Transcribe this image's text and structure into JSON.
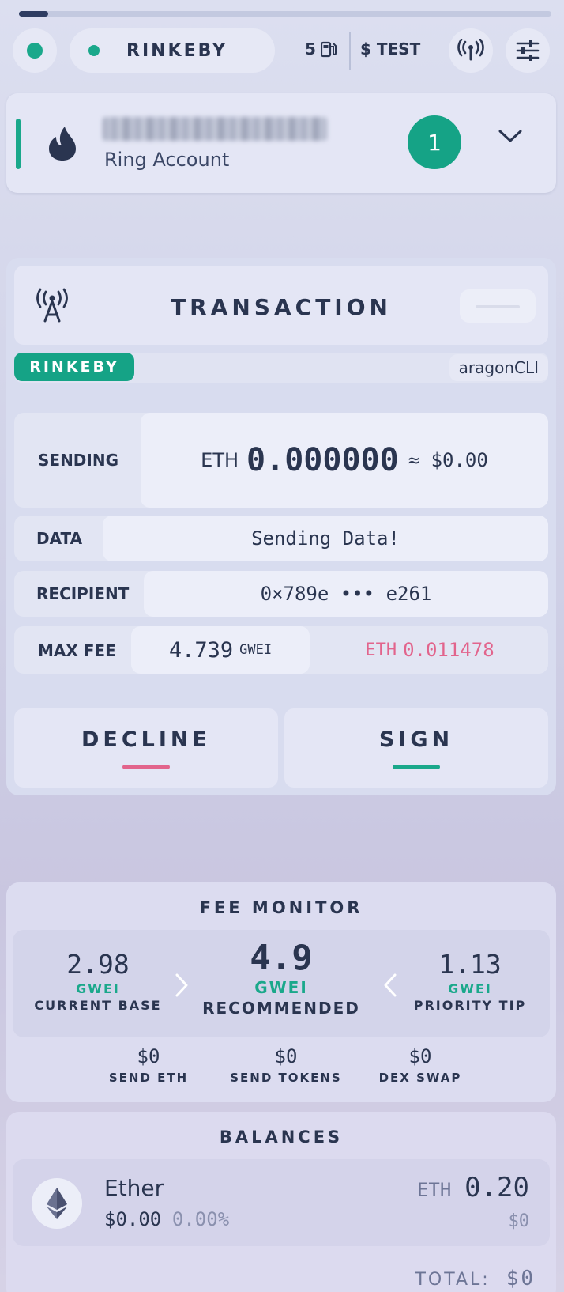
{
  "progress": {
    "fraction": 0.055
  },
  "header": {
    "network_label": "RINKEBY",
    "gas_price": "5",
    "currency_label": "$ TEST"
  },
  "account": {
    "type_label": "Ring Account",
    "pending_count": "1"
  },
  "transaction": {
    "title": "TRANSACTION",
    "network_badge": "RINKEBY",
    "origin": "aragonCLI",
    "sending": {
      "label": "SENDING",
      "currency": "ETH",
      "amount": "0.000000",
      "usd": "≈ $0.00"
    },
    "data": {
      "label": "DATA",
      "value": "Sending Data!"
    },
    "recipient": {
      "label": "RECIPIENT",
      "value": "0×789e ••• e261"
    },
    "max_fee": {
      "label": "MAX FEE",
      "gwei": "4.739",
      "gwei_unit": "GWEI",
      "eth_label": "ETH",
      "eth": "0.011478"
    },
    "decline_label": "DECLINE",
    "sign_label": "SIGN"
  },
  "fee_monitor": {
    "title": "FEE MONITOR",
    "current_base": {
      "value": "2.98",
      "unit": "GWEI",
      "label": "CURRENT BASE"
    },
    "recommended": {
      "value": "4.9",
      "unit": "GWEI",
      "label": "RECOMMENDED"
    },
    "priority_tip": {
      "value": "1.13",
      "unit": "GWEI",
      "label": "PRIORITY TIP"
    },
    "costs": [
      {
        "value": "$0",
        "label": "SEND ETH"
      },
      {
        "value": "$0",
        "label": "SEND TOKENS"
      },
      {
        "value": "$0",
        "label": "DEX SWAP"
      }
    ]
  },
  "balances": {
    "title": "BALANCES",
    "items": [
      {
        "name": "Ether",
        "usd": "$0.00",
        "change": "0.00%",
        "symbol": "ETH",
        "amount": "0.20",
        "value_usd": "$0"
      }
    ],
    "total_label": "TOTAL:",
    "total_value": "$0"
  },
  "colors": {
    "accent": "#1aa88b",
    "decline": "#e2648c",
    "ink": "#2a3550"
  }
}
